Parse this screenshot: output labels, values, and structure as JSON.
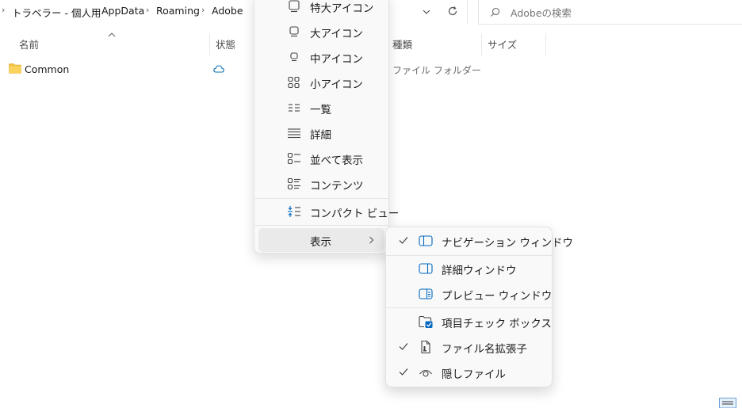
{
  "breadcrumb": [
    "トラベラー - 個人用",
    "AppData",
    "Roaming",
    "Adobe"
  ],
  "search": {
    "placeholder": "Adobeの検索"
  },
  "columns": {
    "name": "名前",
    "status": "状態",
    "type": "種類",
    "size": "サイズ"
  },
  "files": [
    {
      "name": "Common",
      "type": "ファイル フォルダー",
      "status_icon": "cloud-icon"
    }
  ],
  "view_menu": {
    "items": [
      {
        "label": "特大アイコン",
        "icon": "extra-large-icons-icon"
      },
      {
        "label": "大アイコン",
        "icon": "large-icons-icon"
      },
      {
        "label": "中アイコン",
        "icon": "medium-icons-icon"
      },
      {
        "label": "小アイコン",
        "icon": "small-icons-icon"
      },
      {
        "label": "一覧",
        "icon": "list-icon"
      },
      {
        "label": "詳細",
        "icon": "details-icon"
      },
      {
        "label": "並べて表示",
        "icon": "tiles-icon"
      },
      {
        "label": "コンテンツ",
        "icon": "content-icon"
      }
    ],
    "compact": {
      "label": "コンパクト ビュー",
      "icon": "compact-view-icon"
    },
    "show": {
      "label": "表示",
      "icon": "chevron-right-icon"
    }
  },
  "show_submenu": {
    "items": [
      {
        "label": "ナビゲーション ウィンドウ",
        "checked": true,
        "icon": "navigation-pane-icon"
      },
      {
        "label": "詳細ウィンドウ",
        "checked": false,
        "icon": "details-pane-icon"
      },
      {
        "label": "プレビュー ウィンドウ",
        "checked": false,
        "icon": "preview-pane-icon"
      },
      {
        "label": "項目チェック ボックス",
        "checked": false,
        "icon": "item-checkbox-icon"
      },
      {
        "label": "ファイル名拡張子",
        "checked": true,
        "icon": "file-extension-icon"
      },
      {
        "label": "隠しファイル",
        "checked": true,
        "icon": "hidden-files-icon"
      }
    ]
  },
  "colors": {
    "accent": "#0067c0",
    "folder": "#f5c242",
    "menu_bg": "#f9f9f9"
  }
}
